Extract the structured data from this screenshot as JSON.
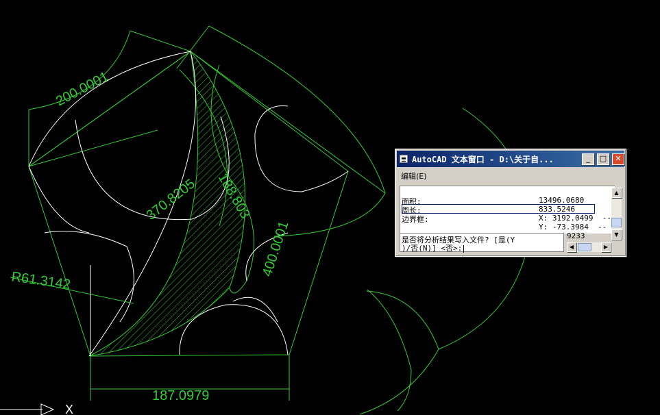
{
  "colors": {
    "background": "#000000",
    "geometry": "#33cc33",
    "arcs": "#ffffff"
  },
  "drawing": {
    "dimensions": {
      "top_left": "200.0001",
      "diagonal": "370.8205",
      "inner": "188.803",
      "right_side": "400.0001",
      "radius": "R61.3142",
      "bottom": "187.0979"
    },
    "axis": {
      "x_label": "X"
    }
  },
  "text_window": {
    "title": "AutoCAD 文本窗口 - D:\\关于自...",
    "buttons": {
      "minimize": "_",
      "maximize": "□",
      "close": "✕"
    },
    "menu": {
      "edit": "编辑(E)"
    },
    "history": [
      {
        "label": "面积:",
        "value": "13496.0680"
      },
      {
        "label": "周长:",
        "value": "833.5246"
      },
      {
        "label": "边界框:",
        "value": "X: 3192.0499  --"
      },
      {
        "label": "",
        "value": "Y: -73.3984  --"
      }
    ],
    "overflow_value": "9233",
    "prompt_line1": "是否将分析结果写入文件? [是(Y",
    "prompt_line2": ")/否(N)] <否>:",
    "scroll_icons": {
      "up": "▲",
      "down": "▼",
      "left": "◀",
      "right": "▶"
    }
  }
}
